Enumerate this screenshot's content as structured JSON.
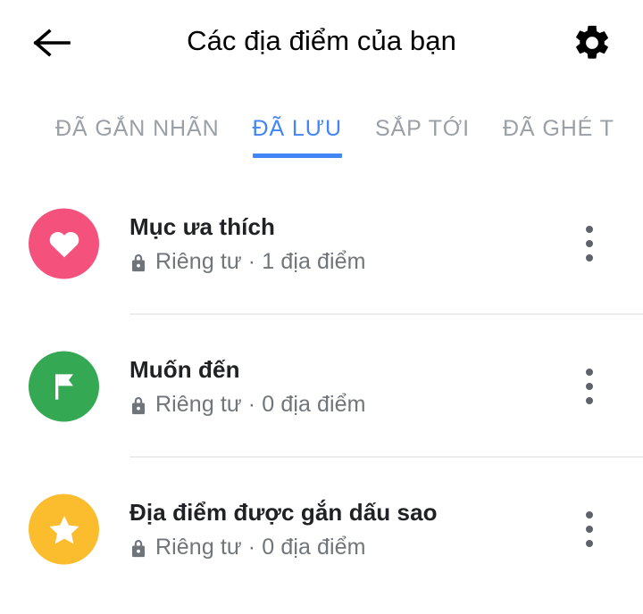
{
  "appbar": {
    "back_icon": "arrow-back-icon",
    "title": "Các địa điểm của bạn",
    "settings_icon": "gear-icon"
  },
  "tabs": {
    "active_index": 1,
    "items": [
      {
        "label": "ĐÃ GẮN NHÃN"
      },
      {
        "label": "ĐÃ LƯU"
      },
      {
        "label": "SẮP TỚI"
      },
      {
        "label": "ĐÃ GHÉ T"
      }
    ]
  },
  "list": {
    "items": [
      {
        "icon": "heart-icon",
        "color": "#F4527D",
        "title": "Mục ưa thích",
        "privacy": "Riêng tư",
        "subtitle": "Riêng tư · 1 địa điểm",
        "count_text": "1 địa điểm",
        "lock_icon": "lock-icon",
        "overflow_icon": "more-vert-icon"
      },
      {
        "icon": "flag-icon",
        "color": "#34A853",
        "title": "Muốn đến",
        "privacy": "Riêng tư",
        "subtitle": "Riêng tư · 0 địa điểm",
        "count_text": "0 địa điểm",
        "lock_icon": "lock-icon",
        "overflow_icon": "more-vert-icon"
      },
      {
        "icon": "star-icon",
        "color": "#FBBC2E",
        "title": "Địa điểm được gắn dấu sao",
        "privacy": "Riêng tư",
        "subtitle": "Riêng tư · 0 địa điểm",
        "count_text": "0 địa điểm",
        "lock_icon": "lock-icon",
        "overflow_icon": "more-vert-icon"
      }
    ]
  },
  "colors": {
    "accent": "#4285F4",
    "tab_inactive": "#9AA0A6",
    "title_text": "#202124",
    "subtitle_text": "#70757A",
    "divider": "#EDEDED"
  }
}
